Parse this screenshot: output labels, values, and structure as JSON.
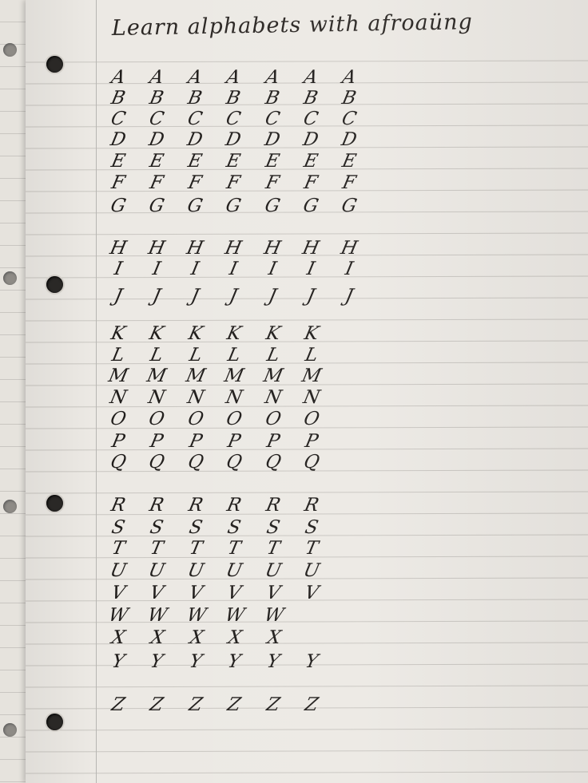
{
  "heading": "Learn alphabets with afroaüng",
  "alphabet": [
    {
      "letter": "A",
      "count": 7
    },
    {
      "letter": "B",
      "count": 7
    },
    {
      "letter": "C",
      "count": 7
    },
    {
      "letter": "D",
      "count": 7
    },
    {
      "letter": "E",
      "count": 7
    },
    {
      "letter": "F",
      "count": 7
    },
    {
      "letter": "G",
      "count": 7
    },
    {
      "letter": "H",
      "count": 7
    },
    {
      "letter": "I",
      "count": 7
    },
    {
      "letter": "J",
      "count": 7
    },
    {
      "letter": "K",
      "count": 6
    },
    {
      "letter": "L",
      "count": 6
    },
    {
      "letter": "M",
      "count": 6
    },
    {
      "letter": "N",
      "count": 6
    },
    {
      "letter": "O",
      "count": 6
    },
    {
      "letter": "P",
      "count": 6
    },
    {
      "letter": "Q",
      "count": 6
    },
    {
      "letter": "R",
      "count": 6
    },
    {
      "letter": "S",
      "count": 6
    },
    {
      "letter": "T",
      "count": 6
    },
    {
      "letter": "U",
      "count": 6
    },
    {
      "letter": "V",
      "count": 6
    },
    {
      "letter": "W",
      "count": 5
    },
    {
      "letter": "X",
      "count": 5
    },
    {
      "letter": "Y",
      "count": 6
    },
    {
      "letter": "Z",
      "count": 6
    }
  ],
  "colors": {
    "ink": "#1f1c1a",
    "paper": "#ece9e4",
    "rule_line": "#c9c6c1",
    "margin_line": "#b8b6b3"
  }
}
